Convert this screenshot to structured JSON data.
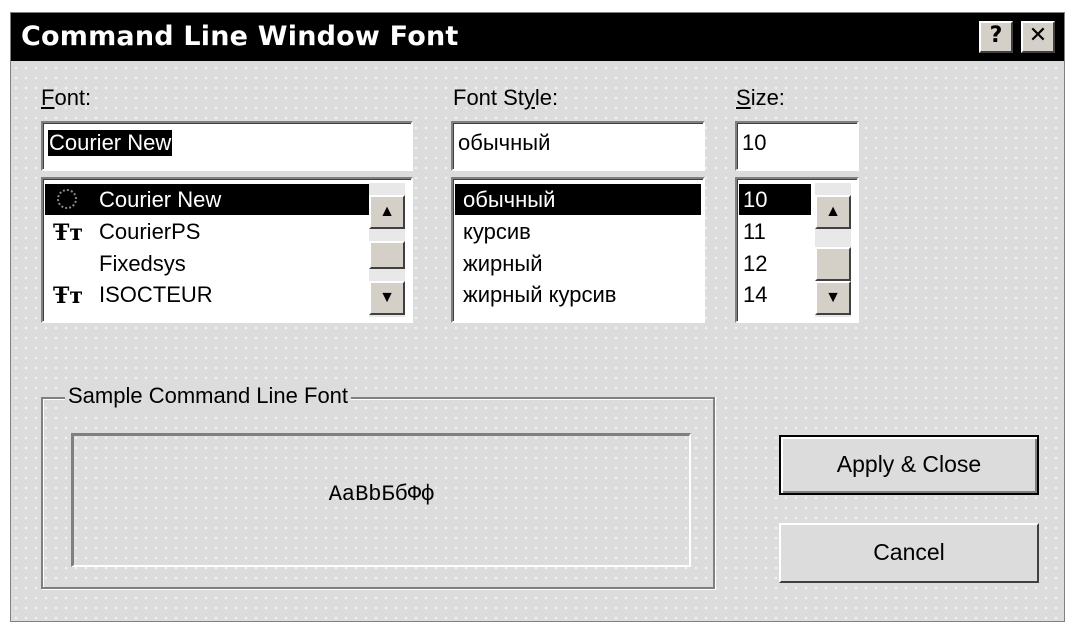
{
  "window": {
    "title": "Command Line Window Font",
    "help_label": "?",
    "close_label": "✕"
  },
  "font": {
    "label_accel": "F",
    "label_rest": "ont:",
    "value": "Courier New",
    "items": [
      {
        "label": "Courier New",
        "icon": "ghost-font-icon",
        "selected": true
      },
      {
        "label": "CourierPS",
        "icon": "truetype-icon",
        "selected": false
      },
      {
        "label": "Fixedsys",
        "icon": "",
        "selected": false
      },
      {
        "label": "ISOCTEUR",
        "icon": "truetype-icon",
        "selected": false
      }
    ],
    "truetype_glyph": "Ŧт"
  },
  "style": {
    "label_pre": "Font St",
    "label_accel": "y",
    "label_post": "le:",
    "value": "обычный",
    "items": [
      {
        "label": "обычный",
        "selected": true
      },
      {
        "label": "курсив",
        "selected": false
      },
      {
        "label": "жирный",
        "selected": false
      },
      {
        "label": "жирный курсив",
        "selected": false
      }
    ]
  },
  "size": {
    "label_accel": "S",
    "label_rest": "ize:",
    "value": "10",
    "items": [
      {
        "label": "10",
        "selected": true
      },
      {
        "label": "11",
        "selected": false
      },
      {
        "label": "12",
        "selected": false
      },
      {
        "label": "14",
        "selected": false
      }
    ]
  },
  "sample": {
    "legend": "Sample Command Line Font",
    "text": "AaBbБбФф"
  },
  "buttons": {
    "apply": "Apply & Close",
    "cancel": "Cancel"
  },
  "scroll_arrows": {
    "up": "▲",
    "down": "▼"
  },
  "colors": {
    "dialog_bg": "#dcdcdc",
    "title_bg": "#000000",
    "selection": "#000000"
  }
}
